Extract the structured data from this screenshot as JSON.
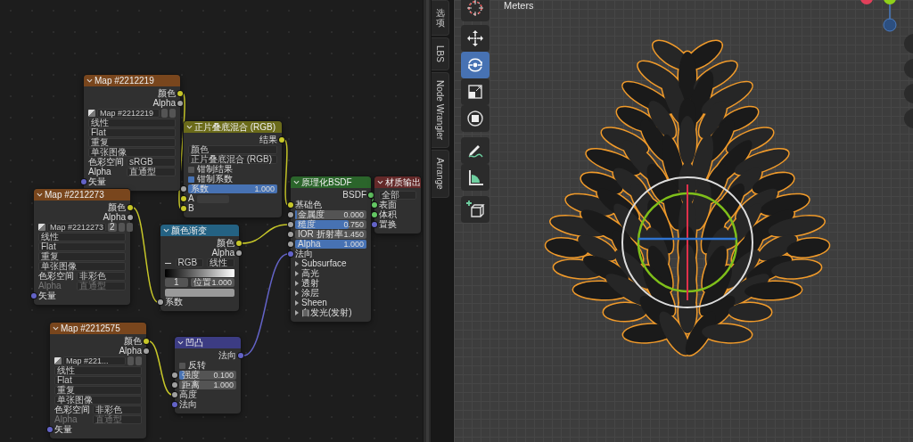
{
  "node_editor": {
    "nodes": [
      {
        "kind": "texture",
        "title": "Map #2212219",
        "rows": [
          {
            "kind": "output",
            "label": "颜色",
            "color": "#c7c729"
          },
          {
            "kind": "output",
            "label": "Alpha",
            "color": "#a1a1a1"
          },
          {
            "kind": "image",
            "name": "Map #2212219"
          },
          {
            "kind": "dropdown",
            "value": "线性"
          },
          {
            "kind": "dropdown",
            "value": "Flat"
          },
          {
            "kind": "dropdown",
            "value": "重复"
          },
          {
            "kind": "dropdown",
            "value": "单张图像"
          },
          {
            "kind": "property",
            "label": "色彩空间",
            "value": "sRGB",
            "disabled": false
          },
          {
            "kind": "property",
            "label": "Alpha",
            "value": "直通型",
            "disabled": false
          },
          {
            "kind": "input",
            "label": "矢量",
            "color": "#6363c7"
          }
        ]
      },
      {
        "kind": "texture",
        "title": "Map #2212273",
        "rows": [
          {
            "kind": "output",
            "label": "颜色",
            "color": "#c7c729"
          },
          {
            "kind": "output",
            "label": "Alpha",
            "color": "#a1a1a1"
          },
          {
            "kind": "image",
            "name": "Map #2212273",
            "users": "2"
          },
          {
            "kind": "dropdown",
            "value": "线性"
          },
          {
            "kind": "dropdown",
            "value": "Flat"
          },
          {
            "kind": "dropdown",
            "value": "重复"
          },
          {
            "kind": "dropdown",
            "value": "单张图像"
          },
          {
            "kind": "property",
            "label": "色彩空间",
            "value": "非彩色",
            "disabled": false
          },
          {
            "kind": "property",
            "label": "Alpha",
            "value": "直通型",
            "disabled": true
          },
          {
            "kind": "input",
            "label": "矢量",
            "color": "#6363c7"
          }
        ]
      },
      {
        "kind": "texture",
        "title": "Map #2212575",
        "rows": [
          {
            "kind": "output",
            "label": "颜色",
            "color": "#c7c729"
          },
          {
            "kind": "output",
            "label": "Alpha",
            "color": "#a1a1a1"
          },
          {
            "kind": "image",
            "name": "Map #221..."
          },
          {
            "kind": "dropdown",
            "value": "线性"
          },
          {
            "kind": "dropdown",
            "value": "Flat"
          },
          {
            "kind": "dropdown",
            "value": "重复"
          },
          {
            "kind": "dropdown",
            "value": "单张图像"
          },
          {
            "kind": "property",
            "label": "色彩空间",
            "value": "非彩色",
            "disabled": false
          },
          {
            "kind": "property",
            "label": "Alpha",
            "value": "直通型",
            "disabled": true
          },
          {
            "kind": "input",
            "label": "矢量",
            "color": "#6363c7"
          }
        ]
      },
      {
        "kind": "color",
        "title": "正片叠底混合 (RGB)",
        "rows": [
          {
            "kind": "output",
            "label": "结果",
            "color": "#c7c729"
          },
          {
            "kind": "dropdown",
            "value": "颜色"
          },
          {
            "kind": "dropdown",
            "value": "正片叠底混合 (RGB)"
          },
          {
            "kind": "checkbox",
            "label": "钳制结果",
            "checked": false
          },
          {
            "kind": "checkbox",
            "label": "钳制系数",
            "checked": true
          },
          {
            "kind": "slider",
            "label": "系数",
            "value": "1.000",
            "level": 1,
            "color": "#a1a1a1"
          },
          {
            "kind": "swatch_input",
            "label": "A",
            "color": "#c7c729"
          },
          {
            "kind": "input",
            "label": "B",
            "color": "#c7c729"
          }
        ]
      },
      {
        "kind": "converter",
        "title": "颜色渐变",
        "rows": [
          {
            "kind": "output",
            "label": "颜色",
            "color": "#c7c729"
          },
          {
            "kind": "output",
            "label": "Alpha",
            "color": "#a1a1a1"
          },
          {
            "kind": "ramp_controls",
            "mode": "RGB",
            "interpolation": "线性"
          },
          {
            "kind": "gradient"
          },
          {
            "kind": "ramp_stop",
            "index": "1",
            "label": "位置",
            "value": "1.000"
          },
          {
            "kind": "swatch"
          },
          {
            "kind": "input",
            "label": "系数",
            "color": "#a1a1a1"
          }
        ]
      },
      {
        "kind": "shader",
        "title": "原理化BSDF",
        "rows": [
          {
            "kind": "output",
            "label": "BSDF",
            "color": "#63c763"
          },
          {
            "kind": "input",
            "label": "基础色",
            "color": "#c7c729"
          },
          {
            "kind": "slider",
            "label": "金属度",
            "value": "0.000",
            "level": 0,
            "color": "#a1a1a1"
          },
          {
            "kind": "slider",
            "label": "糙度",
            "value": "0.750",
            "level": 0.75,
            "color": "#a1a1a1"
          },
          {
            "kind": "number",
            "label": "IOR 折射率",
            "value": "1.450",
            "color": "#a1a1a1"
          },
          {
            "kind": "slider",
            "label": "Alpha",
            "value": "1.000",
            "level": 1,
            "color": "#a1a1a1"
          },
          {
            "kind": "input",
            "label": "法向",
            "color": "#6363c7"
          },
          {
            "kind": "panel",
            "label": "Subsurface"
          },
          {
            "kind": "panel",
            "label": "高光"
          },
          {
            "kind": "panel",
            "label": "透射"
          },
          {
            "kind": "panel",
            "label": "涂层"
          },
          {
            "kind": "panel",
            "label": "Sheen"
          },
          {
            "kind": "panel",
            "label": "自发光(发射)"
          }
        ]
      },
      {
        "kind": "output",
        "title": "材质输出",
        "rows": [
          {
            "kind": "dropdown",
            "value": "全部"
          },
          {
            "kind": "input",
            "label": "表面",
            "color": "#63c763"
          },
          {
            "kind": "input",
            "label": "体积",
            "color": "#63c763"
          },
          {
            "kind": "input",
            "label": "置换",
            "color": "#6363c7"
          }
        ]
      },
      {
        "kind": "vector",
        "title": "凹凸",
        "rows": [
          {
            "kind": "output",
            "label": "法向",
            "color": "#6363c7"
          },
          {
            "kind": "checkbox",
            "label": "反转",
            "checked": false
          },
          {
            "kind": "slider",
            "label": "强度",
            "value": "0.100",
            "level": 0.1,
            "color": "#a1a1a1"
          },
          {
            "kind": "number",
            "label": "距离",
            "value": "1.000",
            "color": "#a1a1a1"
          },
          {
            "kind": "input",
            "label": "高度",
            "color": "#a1a1a1"
          },
          {
            "kind": "input",
            "label": "法向",
            "color": "#6363c7"
          }
        ]
      }
    ]
  },
  "sidebar_tabs": [
    {
      "label": "选项",
      "selected": false
    },
    {
      "label": "LBS",
      "selected": false
    },
    {
      "label": "Node Wrangler",
      "selected": false
    },
    {
      "label": "Arrange",
      "selected": false
    }
  ],
  "viewport": {
    "units_label": "Meters",
    "tools": [
      {
        "kind": "cursor",
        "selected": false
      },
      {
        "kind": "move",
        "selected": false
      },
      {
        "kind": "rotate",
        "selected": true
      },
      {
        "kind": "scale",
        "selected": false
      },
      {
        "kind": "transform",
        "selected": false
      },
      {
        "kind": "annotate",
        "selected": false
      },
      {
        "kind": "measure",
        "selected": false
      },
      {
        "kind": "add_cube",
        "selected": false
      }
    ]
  }
}
